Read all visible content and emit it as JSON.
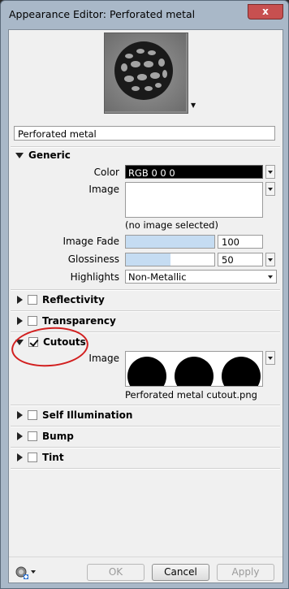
{
  "window": {
    "title": "Appearance Editor: Perforated metal",
    "close_glyph": "x"
  },
  "material_name": "Perforated metal",
  "generic": {
    "header": "Generic",
    "color_label": "Color",
    "color_value": "RGB 0 0 0",
    "image_label": "Image",
    "no_image_text": "(no image selected)",
    "image_fade_label": "Image Fade",
    "image_fade_value": "100",
    "image_fade_fraction": 1.0,
    "glossiness_label": "Glossiness",
    "glossiness_value": "50",
    "glossiness_fraction": 0.5,
    "highlights_label": "Highlights",
    "highlights_value": "Non-Metallic"
  },
  "sections": {
    "reflectivity": "Reflectivity",
    "transparency": "Transparency",
    "cutouts": "Cutouts",
    "self_illumination": "Self Illumination",
    "bump": "Bump",
    "tint": "Tint"
  },
  "cutouts": {
    "image_label": "Image",
    "file_name": "Perforated metal cutout.png"
  },
  "buttons": {
    "ok": "OK",
    "cancel": "Cancel",
    "apply": "Apply"
  },
  "colors": {
    "annotation_circle": "#d21f1f",
    "slider_fill": "#c5dcf2",
    "title_bar": "#a9b8c8"
  }
}
